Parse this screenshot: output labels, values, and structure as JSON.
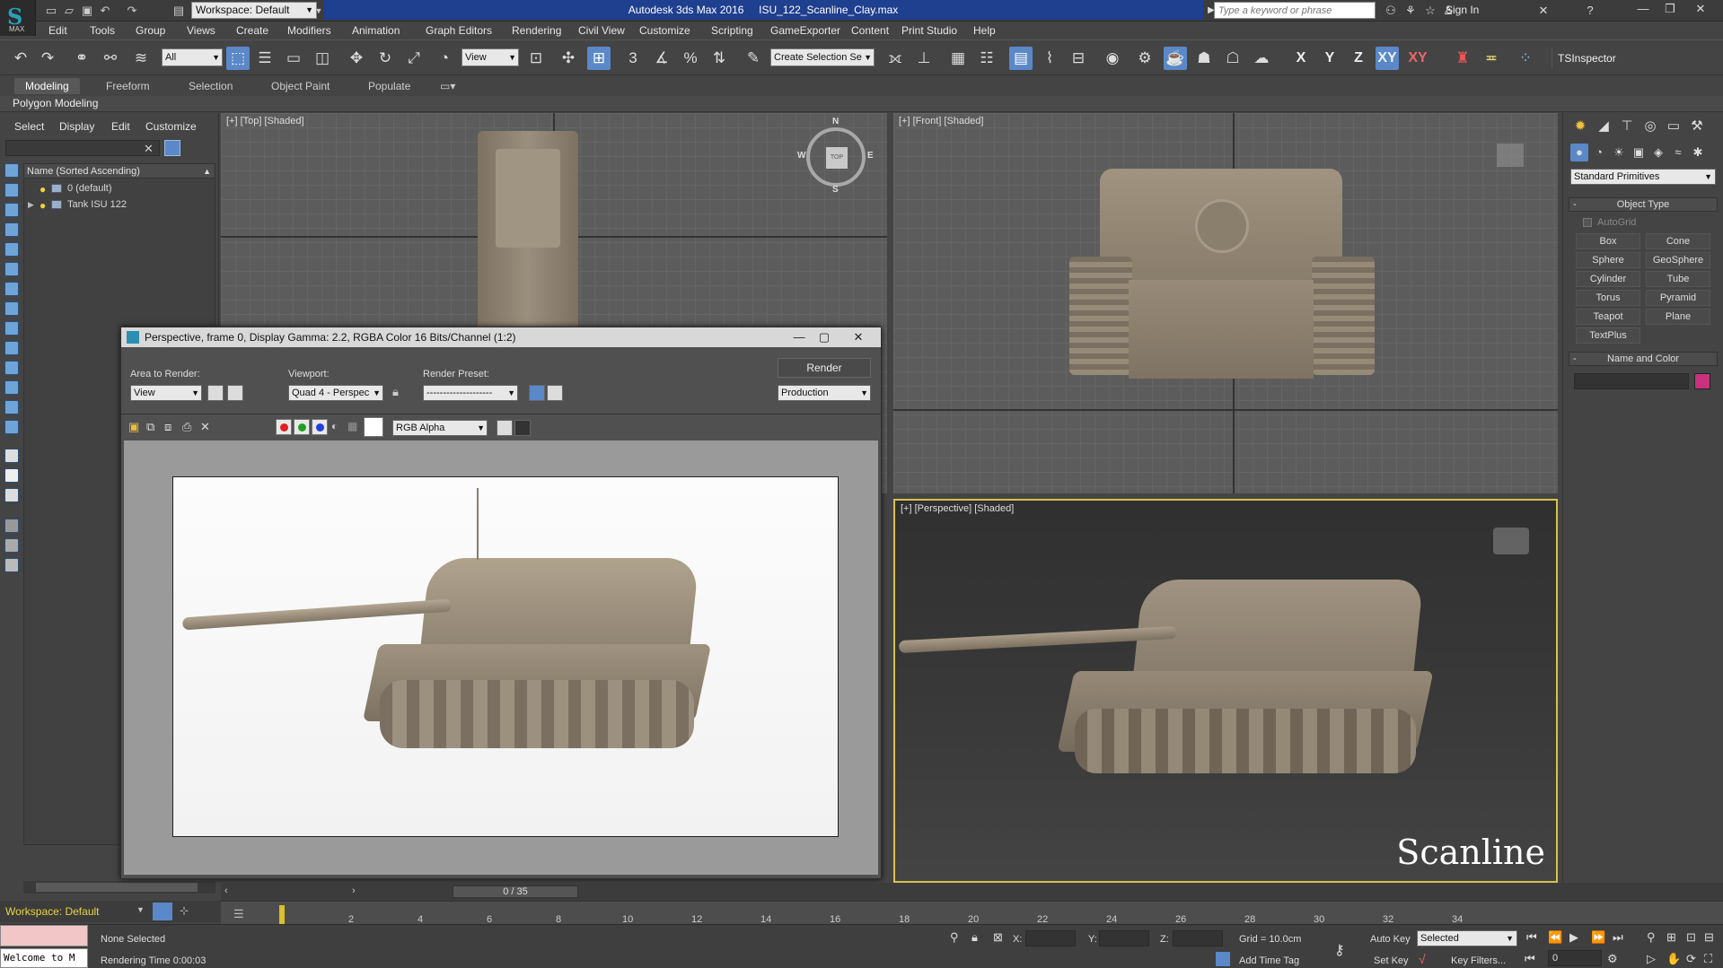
{
  "app": {
    "logo_text": "MAX",
    "title": "Autodesk 3ds Max 2016     ISU_122_Scanline_Clay.max",
    "workspace": "Workspace: Default",
    "search_placeholder": "Type a keyword or phrase",
    "sign_in": "Sign In"
  },
  "menu": [
    "Edit",
    "Tools",
    "Group",
    "Views",
    "Create",
    "Modifiers",
    "Animation",
    "Graph Editors",
    "Rendering",
    "Civil View",
    "Customize",
    "Scripting",
    "GameExporter",
    "Content",
    "Print Studio",
    "Help"
  ],
  "toolbar": {
    "selection_filter": "All",
    "ref_coord": "View",
    "named_selection_placeholder": "Create Selection Se",
    "axis_x": "X",
    "axis_y": "Y",
    "axis_z": "Z",
    "axis_xy": "XY",
    "axis_xy2": "XY",
    "tsinspector": "TSInspector",
    "snap_3": "3",
    "snap_pct": "%"
  },
  "ribbon": {
    "tabs": [
      "Modeling",
      "Freeform",
      "Selection",
      "Object Paint",
      "Populate"
    ],
    "active_tab": "Modeling",
    "panel": "Polygon Modeling"
  },
  "scene_explorer": {
    "menu": [
      "Select",
      "Display",
      "Edit",
      "Customize"
    ],
    "column_header": "Name (Sorted Ascending)",
    "rows": [
      "0 (default)",
      "Tank ISU 122"
    ]
  },
  "viewports": {
    "top_label": "[+] [Top] [Shaded]",
    "front_label": "[+] [Front] [Shaded]",
    "persp_label": "[+] [Perspective] [Shaded]",
    "persp_overlay": "Scanline",
    "viewcube": {
      "face": "TOP",
      "n": "N",
      "s": "S",
      "e": "E",
      "w": "W"
    }
  },
  "render_window": {
    "title": "Perspective, frame 0, Display Gamma: 2.2, RGBA Color 16 Bits/Channel (1:2)",
    "area_label": "Area to Render:",
    "area_value": "View",
    "viewport_label": "Viewport:",
    "viewport_value": "Quad 4 - Perspec",
    "preset_label": "Render Preset:",
    "preset_value": "--------------------",
    "render_button": "Render",
    "production": "Production",
    "channel": "RGB Alpha"
  },
  "timeline": {
    "frame_display": "0 / 35",
    "ticks": [
      "2",
      "4",
      "6",
      "8",
      "10",
      "12",
      "14",
      "16",
      "18",
      "20",
      "22",
      "24",
      "26",
      "28",
      "30",
      "32",
      "34"
    ]
  },
  "status": {
    "workspace": "Workspace: Default",
    "maxscript": "Welcome to M",
    "selection": "None Selected",
    "render_time": "Rendering Time  0:00:03",
    "x_label": "X:",
    "y_label": "Y:",
    "z_label": "Z:",
    "grid": "Grid = 10.0cm",
    "add_time_tag": "Add Time Tag",
    "auto_key": "Auto Key",
    "set_key": "Set Key",
    "selected_dd": "Selected",
    "key_filters": "Key Filters...",
    "frame": "0"
  },
  "command_panel": {
    "primitive_type": "Standard Primitives",
    "object_type_header": "Object Type",
    "autogrid": "AutoGrid",
    "objects": [
      "Box",
      "Cone",
      "Sphere",
      "GeoSphere",
      "Cylinder",
      "Tube",
      "Torus",
      "Pyramid",
      "Teapot",
      "Plane",
      "TextPlus"
    ],
    "name_color_header": "Name and Color",
    "object_color": "#c8327c"
  },
  "colors": {
    "title_highlight": "#1f3f8f",
    "active_blue": "#5a88c8",
    "viewport_active_border": "#d6c24a",
    "clay": "#8f8270"
  }
}
